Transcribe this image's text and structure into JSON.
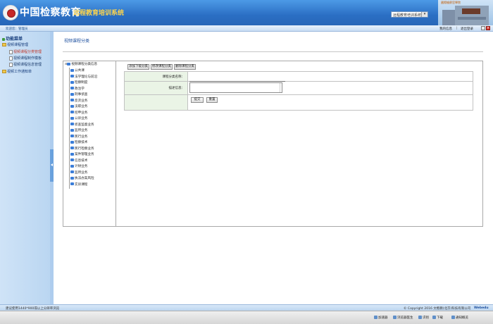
{
  "header": {
    "title": "中国检察教育",
    "subtitle": "远程教育培训系统",
    "system_select": "远程教育培训系统",
    "small_text": "國際檢察官學院"
  },
  "topbar": {
    "welcome": "欢迎您：管理员",
    "personal_info": "我的信息",
    "separator": "|",
    "logout": "退出登录"
  },
  "sidebar": {
    "root": "功能菜单",
    "groups": [
      {
        "label": "视频课程管理",
        "items": [
          {
            "label": "视频课程分类管理",
            "active": true
          },
          {
            "label": "视频课程制作模板",
            "active": false
          },
          {
            "label": "视频课程信息管理",
            "active": false
          }
        ]
      },
      {
        "label": "视频工作通知单",
        "items": []
      }
    ]
  },
  "main": {
    "page_title": "视频课程分类",
    "tree": {
      "root": "视频课程分类信息",
      "nodes": [
        "公共课",
        "法学理论与前沿",
        "检察制度",
        "政治学",
        "刑事侦查",
        "反贪业务",
        "渎职业务",
        "控申业务",
        "公诉业务",
        "侦查监督业务",
        "监所业务",
        "民行业务",
        "检察技术",
        "民行检察业务",
        "案件管理业务",
        "信息技术",
        "计财业务",
        "监所业务",
        "执法办案风险",
        "实训课程"
      ]
    },
    "toolbar": {
      "add_child": "添加下级分类",
      "edit": "修改课程分类",
      "delete": "删除课程分类"
    },
    "form": {
      "name_label": "课程分类名称：",
      "name_value": "",
      "desc_label": "描述信息：",
      "desc_value": "",
      "submit": "提交",
      "reset": "重置"
    }
  },
  "footer": {
    "left": "建议使用1440*900或以上分辨率浏览",
    "right": "© Copyright 2016 文楷教(北京)科技有限公司",
    "brand": "Webedu"
  },
  "taskbar": {
    "items": [
      "加速器",
      "浏览器医生",
      "识别",
      "下载",
      "通知概览"
    ]
  },
  "colors": {
    "header_blue": "#2b6fc4",
    "subtitle_yellow": "#ffd54a",
    "sidebar_bg": "#cfe3f7",
    "active_menu": "#c0392b",
    "form_label_bg": "#eaf4e6"
  }
}
